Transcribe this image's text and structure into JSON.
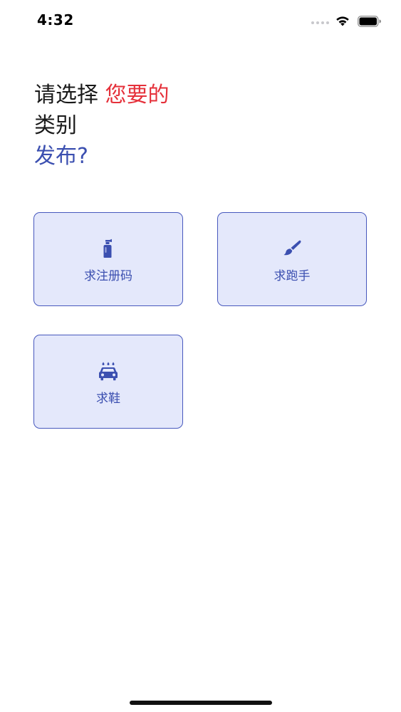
{
  "status_bar": {
    "time": "4:32"
  },
  "heading": {
    "line1_prefix": "请选择 ",
    "line1_accent": "您要的",
    "line2": "类别",
    "line3": "发布?"
  },
  "categories": [
    {
      "label": "求注册码",
      "icon": "spray-bottle-icon"
    },
    {
      "label": "求跑手",
      "icon": "paint-brush-icon"
    },
    {
      "label": "求鞋",
      "icon": "car-wash-icon"
    }
  ],
  "colors": {
    "accent_red": "#e5303a",
    "accent_blue": "#3b4fb0",
    "card_bg": "#e4e8fb",
    "card_border": "#4758bd"
  }
}
